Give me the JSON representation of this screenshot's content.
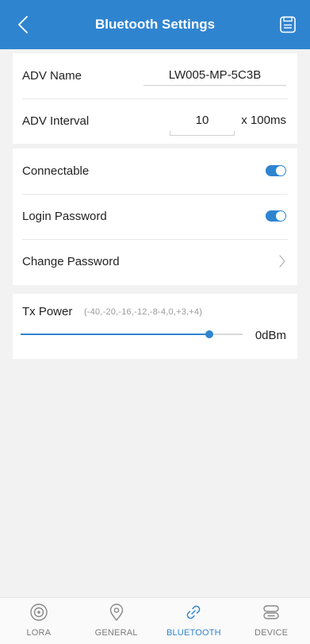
{
  "header": {
    "title": "Bluetooth Settings",
    "back_icon": "back-chevron-icon",
    "save_icon": "save-icon",
    "background": "#2f84d0"
  },
  "adv": {
    "name_label": "ADV Name",
    "name_value": "LW005-MP-5C3B",
    "interval_label": "ADV Interval",
    "interval_value": "10",
    "interval_unit": "x 100ms"
  },
  "connection": {
    "connectable_label": "Connectable",
    "connectable_on": true,
    "login_password_label": "Login Password",
    "login_password_on": true,
    "change_password_label": "Change Password"
  },
  "tx_power": {
    "label": "Tx Power",
    "range_hint": "(-40,-20,-16,-12,-8-4,0,+3,+4)",
    "value": "0dBm",
    "level_fraction": 0.85
  },
  "nav": {
    "items": [
      {
        "label": "LORA",
        "icon": "lora-icon",
        "active": false
      },
      {
        "label": "GENERAL",
        "icon": "location-pin-icon",
        "active": false
      },
      {
        "label": "BLUETOOTH",
        "icon": "link-icon",
        "active": true
      },
      {
        "label": "DEVICE",
        "icon": "device-icon",
        "active": false
      }
    ]
  },
  "colors": {
    "accent": "#2f84d0",
    "background": "#f2f2f2"
  }
}
